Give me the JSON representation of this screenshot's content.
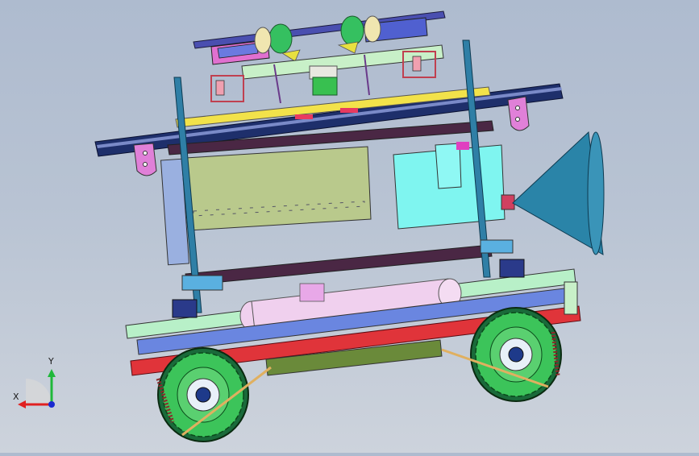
{
  "triad": {
    "x_label": "X",
    "y_label": "Y"
  },
  "colors": {
    "background_top": "#aebbcf",
    "background_bottom": "#cdd3dc",
    "chassis_red": "#e0343a",
    "frame_green": "#b8f0c8",
    "rail_navy": "#1e2f6b",
    "post_teal": "#2f7fa6",
    "horn_teal": "#2a84a8",
    "tire_green": "#3cc45a",
    "box_cyan": "#7ff5f0",
    "panel_olive": "#b9c98c",
    "beam_purple": "#4a2744",
    "beam_yellow": "#f2e24a",
    "tank_pink": "#f0d0ee"
  }
}
